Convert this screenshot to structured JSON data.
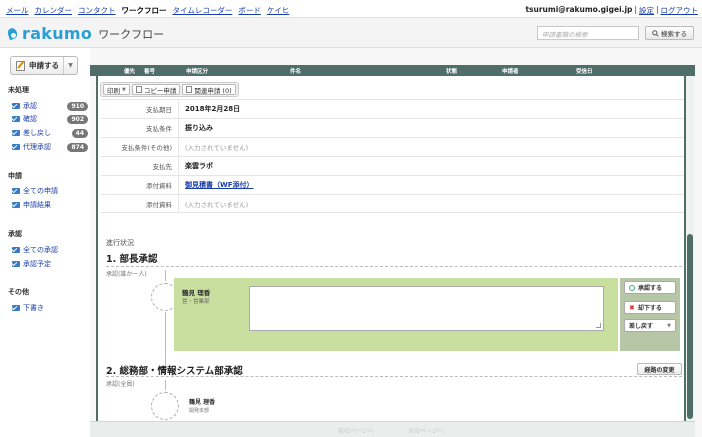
{
  "topnav": {
    "links": [
      {
        "label": "メール",
        "current": false
      },
      {
        "label": "カレンダー",
        "current": false
      },
      {
        "label": "コンタクト",
        "current": false
      },
      {
        "label": "ワークフロー",
        "current": true
      },
      {
        "label": "タイムレコーダー",
        "current": false
      },
      {
        "label": "ボード",
        "current": false
      },
      {
        "label": "ケイヒ",
        "current": false
      }
    ],
    "account_email": "tsurumi@rakumo.gigei.jp",
    "separator": "|",
    "settings_label": "設定",
    "logout_label": "ログアウト"
  },
  "header": {
    "brand": "rakumo",
    "module": "ワークフロー",
    "search_placeholder": "申請書類の検索",
    "search_button": "検索する"
  },
  "sidebar": {
    "apply_button": "申請する",
    "sections": [
      {
        "title": "未処理",
        "items": [
          {
            "label": "承認",
            "count": "910"
          },
          {
            "label": "確認",
            "count": "902"
          },
          {
            "label": "差し戻し",
            "count": "44"
          },
          {
            "label": "代理承認",
            "count": "874"
          }
        ]
      },
      {
        "title": "申請",
        "items": [
          {
            "label": "全ての申請"
          },
          {
            "label": "申請結果"
          }
        ]
      },
      {
        "title": "承認",
        "items": [
          {
            "label": "全ての承認"
          },
          {
            "label": "承認予定"
          }
        ]
      },
      {
        "title": "その他",
        "items": [
          {
            "label": "下書き"
          }
        ]
      }
    ]
  },
  "table_header": [
    "優先",
    "番号",
    "申請区分",
    "件名",
    "状態",
    "申請者",
    "受信日"
  ],
  "toolbar": {
    "print": "印刷",
    "copy": "コピー申請",
    "related": "関連申請 (0)"
  },
  "details": [
    {
      "key": "支払期日",
      "value": "2018年2月28日",
      "style": "b"
    },
    {
      "key": "支払条件",
      "value": "振り込み",
      "style": "b"
    },
    {
      "key": "支払条件(その他)",
      "value": "(入力されていません)",
      "style": "g"
    },
    {
      "key": "支払先",
      "value": "楽雲ラボ",
      "style": "b"
    },
    {
      "key": "添付資料",
      "value": "御見積書（WF添付）",
      "style": "l"
    },
    {
      "key": "添付資料",
      "value": "(入力されていません)",
      "style": "g"
    }
  ],
  "progress": {
    "label": "進行状況",
    "step1": {
      "title": "1. 部長承認",
      "sub": "承認(誰か一人)",
      "person": "鶴見 理香",
      "dept": "営・営業部"
    },
    "actions": {
      "approve": "承認する",
      "reject": "却下する",
      "return": "差し戻す"
    },
    "step2": {
      "title": "2. 総務部・情報システム部承認",
      "sub": "承認(全員)",
      "route_button": "経路の変更",
      "person": "鶴見 理香",
      "dept": "開発本部"
    }
  },
  "footer": {
    "left": "前のページへ",
    "right": "次のページへ"
  },
  "colors": {
    "brand": "#2a9fd6",
    "header_band": "#4f6e68",
    "approval_panel": "#c9dfa0"
  }
}
